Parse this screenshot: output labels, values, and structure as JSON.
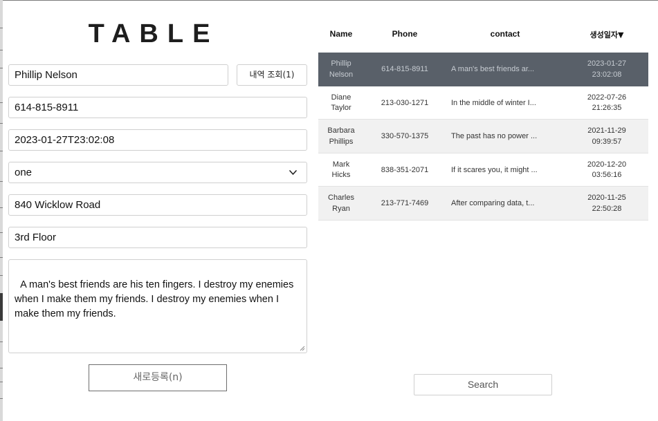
{
  "title": "TABLE",
  "form": {
    "name": "Phillip Nelson",
    "history_button": "내역 조회(1)",
    "phone": "614-815-8911",
    "datetime": "2023-01-27T23:02:08",
    "select_value": "one",
    "address1": "840 Wicklow Road",
    "address2": "3rd Floor",
    "memo": "A man's best friends are his ten fingers. I destroy my enemies when I make them my friends. I destroy my enemies when I make them my friends.",
    "new_button": "새로등록(n)"
  },
  "table": {
    "columns": [
      "Name",
      "Phone",
      "contact",
      "생성일자▼"
    ],
    "rows": [
      {
        "name1": "Phillip",
        "name2": "Nelson",
        "phone": "614-815-8911",
        "contact": "A man's best friends ar...",
        "date": "2023-01-27",
        "time": "23:02:08"
      },
      {
        "name1": "Diane",
        "name2": "Taylor",
        "phone": "213-030-1271",
        "contact": "In the middle of winter I...",
        "date": "2022-07-26",
        "time": "21:26:35"
      },
      {
        "name1": "Barbara",
        "name2": "Phillips",
        "phone": "330-570-1375",
        "contact": "The past has no power ...",
        "date": "2021-11-29",
        "time": "09:39:57"
      },
      {
        "name1": "Mark",
        "name2": "Hicks",
        "phone": "838-351-2071",
        "contact": "If it scares you, it might ...",
        "date": "2020-12-20",
        "time": "03:56:16"
      },
      {
        "name1": "Charles",
        "name2": "Ryan",
        "phone": "213-771-7469",
        "contact": "After comparing data, t...",
        "date": "2020-11-25",
        "time": "22:50:28"
      }
    ]
  },
  "search_button": "Search",
  "colors": {
    "selected_row": "#596069",
    "alt_row": "#f1f1f1"
  },
  "icons": {
    "select": "chevron-down-icon",
    "textarea": "resize-grip-icon"
  }
}
